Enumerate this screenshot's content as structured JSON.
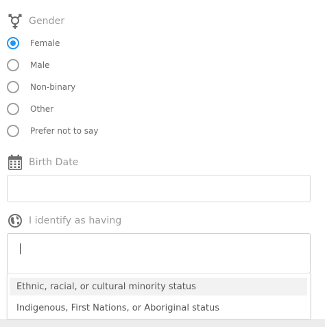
{
  "gender": {
    "title": "Gender",
    "icon": "gender-icon",
    "options": [
      {
        "label": "Female",
        "checked": true
      },
      {
        "label": "Male",
        "checked": false
      },
      {
        "label": "Non-binary",
        "checked": false
      },
      {
        "label": "Other",
        "checked": false
      },
      {
        "label": "Prefer not to say",
        "checked": false
      }
    ]
  },
  "birth_date": {
    "title": "Birth Date",
    "icon": "calendar-icon",
    "value": ""
  },
  "identity": {
    "title": "I identify as having",
    "icon": "globe-icon",
    "value": "",
    "dropdown_options": [
      "Ethnic, racial, or cultural minority status",
      "Indigenous, First Nations, or Aboriginal status"
    ]
  },
  "colors": {
    "accent": "#2196f3",
    "label": "#9a9a9a",
    "border": "#d9d9d9"
  }
}
